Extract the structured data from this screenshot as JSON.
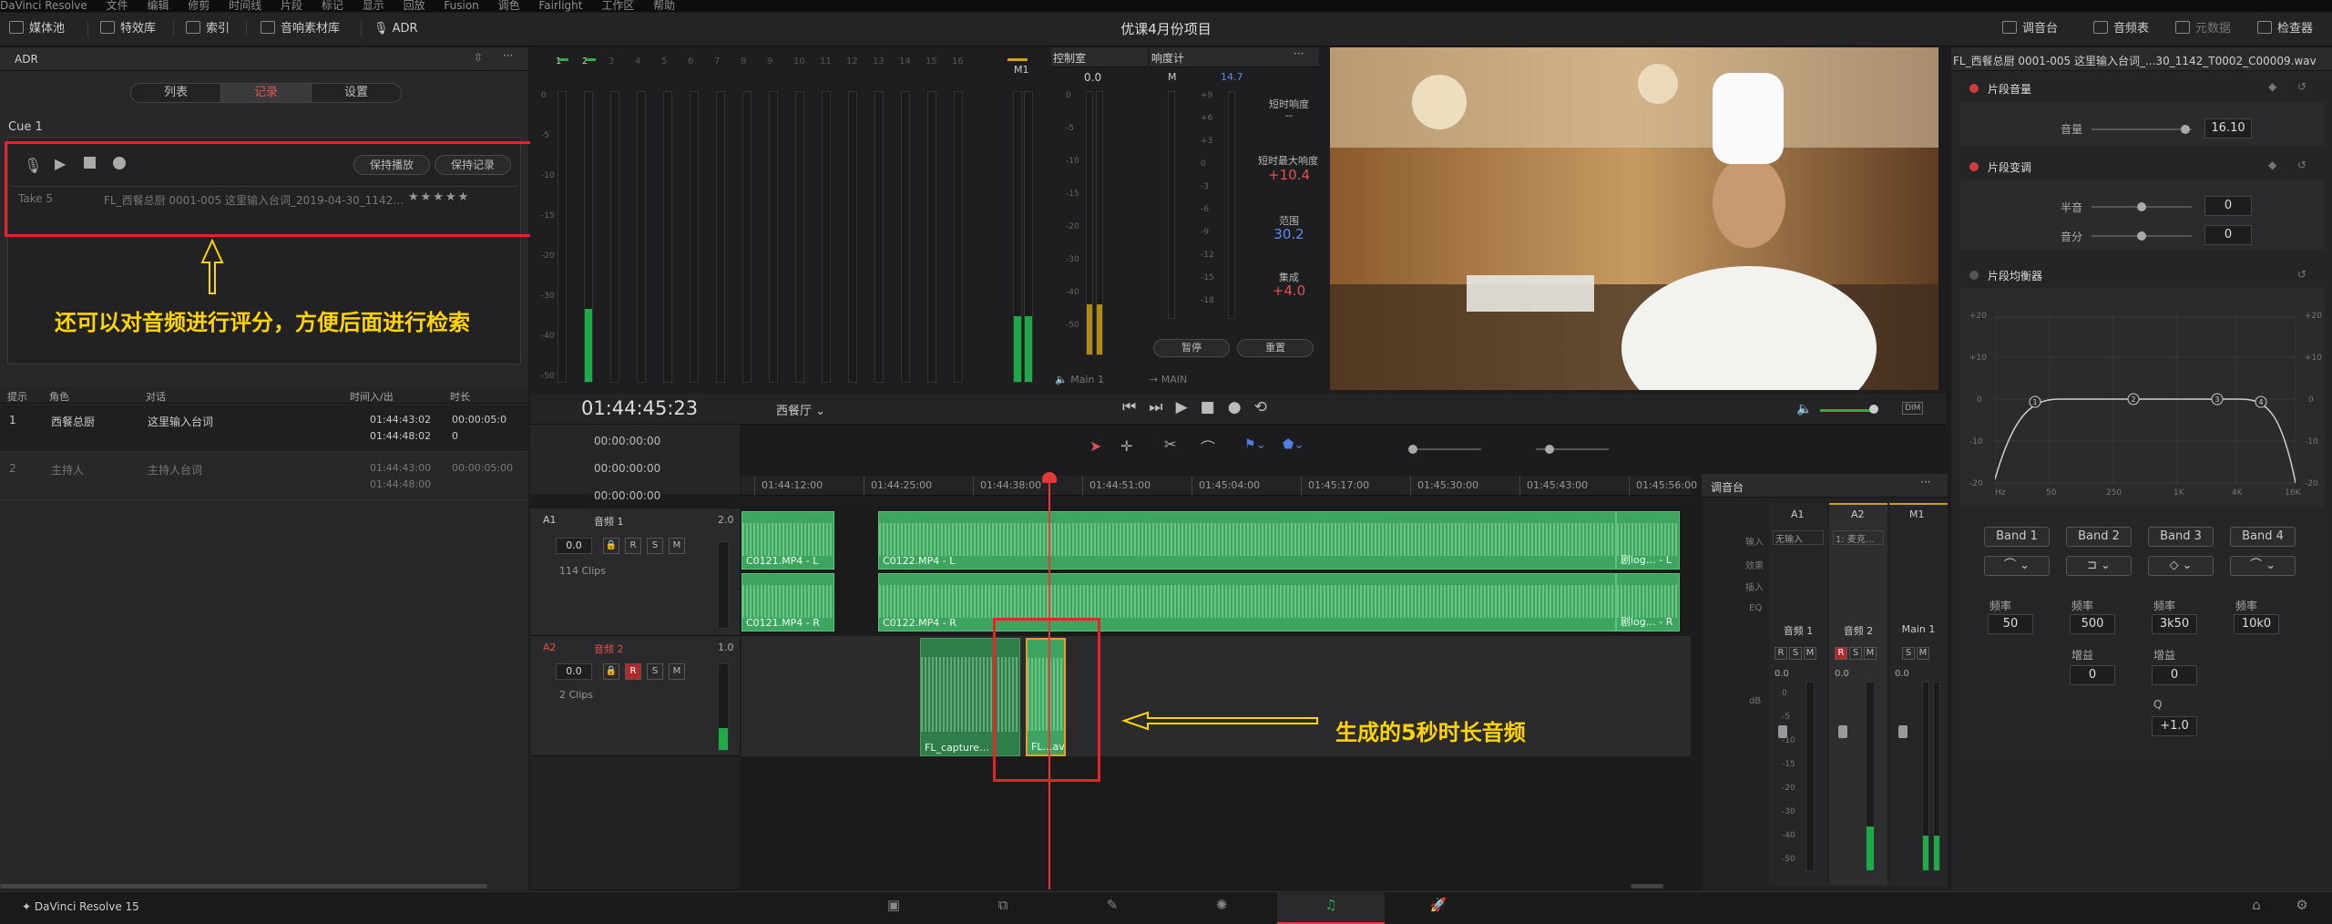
{
  "menu": [
    "DaVinci Resolve",
    "文件",
    "编辑",
    "修剪",
    "时间线",
    "片段",
    "标记",
    "显示",
    "回放",
    "Fusion",
    "调色",
    "Fairlight",
    "工作区",
    "帮助"
  ],
  "toolbar": {
    "media_pool": "媒体池",
    "effects": "特效库",
    "index": "索引",
    "sound_library": "音响素材库",
    "adr": "ADR",
    "project_title": "优课4月份项目",
    "mixer": "调音台",
    "meters": "音频表",
    "metadata": "元数据",
    "inspector": "检查器"
  },
  "adr": {
    "title": "ADR",
    "tabs": [
      "列表",
      "记录",
      "设置"
    ],
    "active_tab": "记录",
    "cue": "Cue 1",
    "hold_play": "保持播放",
    "hold_record": "保持记录",
    "take_name": "Take 5",
    "take_file": "FL_西餐总厨 0001-005 这里输入台词_2019-04-30_1142…",
    "rating": "★★★★★",
    "annotation": "还可以对音频进行评分，方便后面进行检索",
    "list_headers": [
      "提示",
      "角色",
      "对话",
      "时间入/出",
      "时长"
    ],
    "rows": [
      {
        "n": "1",
        "role": "西餐总厨",
        "line": "这里输入台词",
        "in": "01:44:43:02",
        "out": "01:44:48:02",
        "dur": "00:00:05:0",
        "dur2": "0"
      },
      {
        "n": "2",
        "role": "主持人",
        "line": "主持人台词",
        "in": "01:44:43:00",
        "out": "01:44:48:00",
        "dur": "00:00:05:00",
        "dur2": ""
      }
    ]
  },
  "meters": {
    "channels": [
      "1",
      "2",
      "3",
      "4",
      "5",
      "6",
      "7",
      "8",
      "9",
      "10",
      "11",
      "12",
      "13",
      "14",
      "15",
      "16"
    ],
    "master": "M1",
    "scale": [
      "0",
      "-5",
      "-10",
      "-15",
      "-20",
      "-30",
      "-40",
      "-50"
    ]
  },
  "control_room": {
    "title": "控制室",
    "value": "0.0",
    "out": "Main 1",
    "scale": [
      "0",
      "-5",
      "-10",
      "-15",
      "-20",
      "-30",
      "-40",
      "-50"
    ]
  },
  "loudness": {
    "title": "响度计",
    "m": "M",
    "mv": "14.7",
    "short": "短时响度",
    "short_v": "--",
    "max": "短时最大响度",
    "max_v": "+10.4",
    "range": "范围",
    "range_v": "30.2",
    "integrated": "集成",
    "integrated_v": "+4.0",
    "pause": "暂停",
    "reset": "重置",
    "out": "MAIN",
    "scale": [
      "+9",
      "+6",
      "+3",
      "0",
      "-3",
      "-6",
      "-9",
      "-12",
      "-15",
      "-18"
    ]
  },
  "timeline": {
    "timecode": "01:44:45:23",
    "name": "西餐厅",
    "tc_rows": [
      "00:00:00:00",
      "00:00:00:00",
      "00:00:00:00"
    ],
    "ruler": [
      "01:44:12:00",
      "01:44:25:00",
      "01:44:38:00",
      "01:44:51:00",
      "01:45:04:00",
      "01:45:17:00",
      "01:45:30:00",
      "01:45:43:00",
      "01:45:56:00"
    ],
    "a1": {
      "id": "A1",
      "name": "音频 1",
      "ch": "2.0",
      "vol": "0.0",
      "clips": "114 Clips"
    },
    "a2": {
      "id": "A2",
      "name": "音频 2",
      "ch": "1.0",
      "vol": "0.0",
      "clips": "2 Clips"
    },
    "clip_labels": [
      "C0121.MP4 - L",
      "C0122.MP4 - L",
      "剧log… - L",
      "C0121.MP4 - R",
      "C0122.MP4 - R",
      "剧log… - R",
      "FL_capture…",
      "FL…av"
    ],
    "annotation": "生成的5秒时长音频"
  },
  "mixer": {
    "title": "调音台",
    "cols": [
      "A1",
      "A2",
      "M1"
    ],
    "inputs": [
      "无输入",
      "1: 麦克…"
    ],
    "row_labels": [
      "输入",
      "效果",
      "插入",
      "EQ"
    ],
    "names": [
      "音频 1",
      "音频 2",
      "Main 1"
    ],
    "vals": [
      "0.0",
      "0.0",
      "0.0"
    ],
    "db": "dB",
    "scale": [
      "0",
      "-5",
      "-10",
      "-15",
      "-20",
      "-30",
      "-40",
      "-50"
    ]
  },
  "inspector": {
    "file": "FL_西餐总厨 0001-005 这里输入台词_...30_1142_T0002_C00009.wav",
    "clip_volume": "片段音量",
    "volume": "音量",
    "volume_v": "16.10",
    "pitch": "片段变调",
    "semitones": "半音",
    "semitones_v": "0",
    "cents": "音分",
    "cents_v": "0",
    "eq": "片段均衡器",
    "eq_y": [
      "+20",
      "+10",
      "0",
      "-10",
      "-20"
    ],
    "eq_x": [
      "Hz",
      "50",
      "250",
      "1K",
      "4K",
      "16K"
    ],
    "bands": [
      {
        "name": "Band 1",
        "freq_l": "频率",
        "freq": "50",
        "gain_l": "",
        "gain": ""
      },
      {
        "name": "Band 2",
        "freq_l": "频率",
        "freq": "500",
        "gain_l": "增益",
        "gain": "0"
      },
      {
        "name": "Band 3",
        "freq_l": "频率",
        "freq": "3k50",
        "gain_l": "增益",
        "gain": "0",
        "q_l": "Q",
        "q": "+1.0"
      },
      {
        "name": "Band 4",
        "freq_l": "频率",
        "freq": "10k0",
        "gain_l": "",
        "gain": ""
      }
    ]
  },
  "footer": {
    "app": "DaVinci Resolve 15"
  },
  "colors": {
    "accent_red": "#e3242b",
    "annotation": "#ffd400",
    "clip_green": "#3da560",
    "playhead": "#e03a3a"
  }
}
